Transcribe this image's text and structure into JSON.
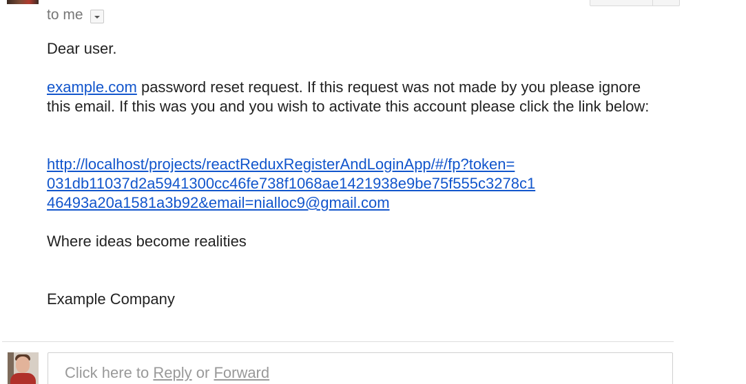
{
  "header": {
    "recipient_label": "to me",
    "details_toggle_icon": "chevron-down-icon"
  },
  "message": {
    "greeting": "Dear user.",
    "site_link": "example.com",
    "paragraph_text": " password reset request. If this request was not made by you please ignore this email. If this was you and you wish to activate this account please click the link below:",
    "reset_link_line1": "http://localhost/projects/reactReduxRegisterAndLoginApp/#/fp?token=",
    "reset_link_line2": "031db11037d2a5941300cc46fe738f1068ae1421938e9be75f555c3278c1",
    "reset_link_line3": "46493a20a1581a3b92&email=nialloc9@gmail.com",
    "slogan": "Where ideas become realities",
    "signature": "Example Company"
  },
  "reply_bar": {
    "prefix": "Click here to ",
    "reply_label": "Reply",
    "or_text": " or ",
    "forward_label": "Forward"
  },
  "colors": {
    "link": "#1155cc",
    "text": "#222222",
    "muted": "#777777"
  }
}
